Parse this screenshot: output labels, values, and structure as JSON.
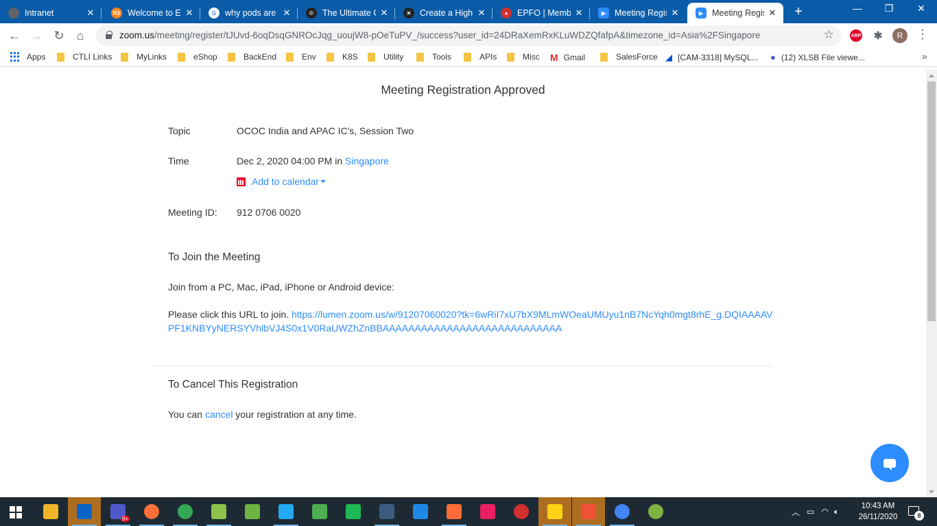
{
  "browser": {
    "tabs": [
      {
        "title": "Intranet",
        "icon": "globe-icon",
        "color": "#5f6368",
        "active": false
      },
      {
        "title": "Welcome to Es",
        "icon": "rs-logo-icon",
        "color": "#f58220",
        "active": false
      },
      {
        "title": "why pods are",
        "icon": "google-icon",
        "color": "#4285f4",
        "active": false
      },
      {
        "title": "The Ultimate C",
        "icon": "c-logo-icon",
        "color": "#222222",
        "active": false
      },
      {
        "title": "Create a High",
        "icon": "x-logo-icon",
        "color": "#222222",
        "active": false
      },
      {
        "title": "EPFO | Membe",
        "icon": "epfo-logo-icon",
        "color": "#d32f2f",
        "active": false
      },
      {
        "title": "Meeting Regis",
        "icon": "zoom-icon",
        "color": "#2d8cff",
        "active": false
      },
      {
        "title": "Meeting Regis",
        "icon": "zoom-icon",
        "color": "#2d8cff",
        "active": true
      }
    ],
    "new_tab": "+",
    "url_main": "zoom.us",
    "url_rest": "/meeting/register/tJUvd-6oqDsqGNROcJqg_uoujW8-pOeTuPV_/success?user_id=24DRaXemRxKLuWDZQfafpA&timezone_id=Asia%2FSingapore",
    "profile_initial": "R",
    "abp_label": "ABP"
  },
  "bookmarks": [
    {
      "label": "Apps",
      "icon": "apps-grid-icon"
    },
    {
      "label": "CTLI Links",
      "icon": "folder-icon"
    },
    {
      "label": "MyLinks",
      "icon": "folder-icon"
    },
    {
      "label": "eShop",
      "icon": "folder-icon"
    },
    {
      "label": "BackEnd",
      "icon": "folder-icon"
    },
    {
      "label": "Env",
      "icon": "folder-icon"
    },
    {
      "label": "K8S",
      "icon": "folder-icon"
    },
    {
      "label": "Utility",
      "icon": "folder-icon"
    },
    {
      "label": "Tools",
      "icon": "folder-icon"
    },
    {
      "label": "APIs",
      "icon": "folder-icon"
    },
    {
      "label": "Misc",
      "icon": "folder-icon"
    },
    {
      "label": "Gmail",
      "icon": "gmail-icon"
    },
    {
      "label": "SalesForce",
      "icon": "folder-icon"
    },
    {
      "label": "[CAM-3318] MySQL...",
      "icon": "jira-icon"
    },
    {
      "label": "(12) XLSB File viewe...",
      "icon": "teams-icon"
    }
  ],
  "page": {
    "heading": "Meeting Registration Approved",
    "topic_label": "Topic",
    "topic_value": "OCOC India and APAC IC's, Session Two",
    "time_label": "Time",
    "time_value": "Dec 2, 2020 04:00 PM",
    "time_in": "in",
    "time_zone": "Singapore",
    "add_calendar": "Add to calendar",
    "meeting_id_label": "Meeting ID:",
    "meeting_id_value": "912 0706 0020",
    "join_heading": "To Join the Meeting",
    "join_devices": "Join from a PC, Mac, iPad, iPhone or Android device:",
    "join_prefix": "Please click this URL to join.",
    "join_url": "https://lumen.zoom.us/w/91207060020?tk=6wRiI7xU7bX9MLmWOeaUMUyu1nB7NcYqh0mgt8rhE_g.DQIAAAAVPF1KNBYyNERSYVhlbVJ4S0x1V0RaUWZhZnBBAAAAAAAAAAAAAAAAAAAAAAAAAAAA",
    "cancel_heading": "To Cancel This Registration",
    "cancel_prefix": "You can",
    "cancel_link": "cancel",
    "cancel_suffix": "your registration at any time."
  },
  "taskbar": {
    "apps": [
      {
        "name": "file-explorer-icon",
        "color": "#f0b429"
      },
      {
        "name": "outlook-icon",
        "color": "#0a64c8"
      },
      {
        "name": "teams-icon",
        "color": "#5059c9",
        "badge": "9+"
      },
      {
        "name": "firefox-icon",
        "color": "#ff7139"
      },
      {
        "name": "chrome-icon",
        "color": "#34a853"
      },
      {
        "name": "notepad-plus-icon",
        "color": "#8bc34a"
      },
      {
        "name": "spring-tools-icon",
        "color": "#6db33f"
      },
      {
        "name": "vscode-icon",
        "color": "#23a9f2"
      },
      {
        "name": "robo3t-icon",
        "color": "#4caf50"
      },
      {
        "name": "app-green-icon",
        "color": "#1db954"
      },
      {
        "name": "mysql-workbench-icon",
        "color": "#3b5c7d"
      },
      {
        "name": "screen-recorder-icon",
        "color": "#1e88e5"
      },
      {
        "name": "postman-icon",
        "color": "#ff6c37"
      },
      {
        "name": "snipping-tool-icon",
        "color": "#e91e63"
      },
      {
        "name": "app-ball-icon",
        "color": "#d32f2f"
      },
      {
        "name": "sticky-notes-icon",
        "color": "#fcd116"
      },
      {
        "name": "git-icon",
        "color": "#f05033"
      },
      {
        "name": "chrome-icon",
        "color": "#4285f4"
      },
      {
        "name": "app-globe-icon",
        "color": "#7cb342"
      }
    ],
    "time": "10:43 AM",
    "date": "26/11/2020",
    "notifications": "8"
  }
}
